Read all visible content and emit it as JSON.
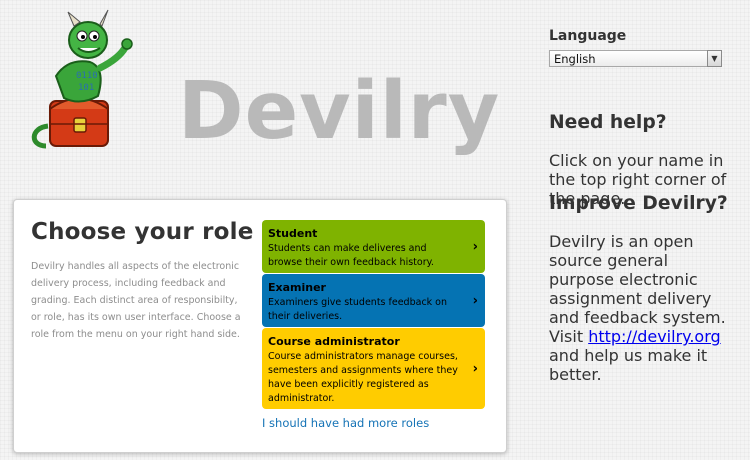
{
  "brand": {
    "title": "Devilry",
    "logo": "devil-mascot-with-treasure-chest"
  },
  "main": {
    "heading": "Choose your role",
    "intro": "Devilry handles all aspects of the electronic delivery process, including feedback and grading. Each distinct area of responsibilty, or role, has its own user interface. Choose a role from the menu on your right hand side.",
    "roles": [
      {
        "title": "Student",
        "description": "Students can make deliveres and browse their own feedback history.",
        "color": "#7fb300"
      },
      {
        "title": "Examiner",
        "description": "Examiners give students feedback on their deliveries.",
        "color": "#0573b3"
      },
      {
        "title": "Course administrator",
        "description": "Course administrators manage courses, semesters and assignments where they have been explicitly registered as administrator.",
        "color": "#ffcc00"
      }
    ],
    "more_roles_link": "I should have had more roles",
    "chevron_icon": "chevron-right-icon"
  },
  "sidebar": {
    "language": {
      "heading": "Language",
      "selected": "English"
    },
    "help": {
      "heading": "Need help?",
      "text": "Click on your name in the top right corner of the page."
    },
    "improve": {
      "heading": "Improve Devilry?",
      "text_before": "Devilry is an open source general purpose electronic assignment delivery and feedback system. Visit ",
      "link": "http://devilry.org",
      "text_after": " and help us make it better."
    }
  },
  "colors": {
    "link": "#1573b6",
    "brand_gray": "#b9b9b9"
  }
}
